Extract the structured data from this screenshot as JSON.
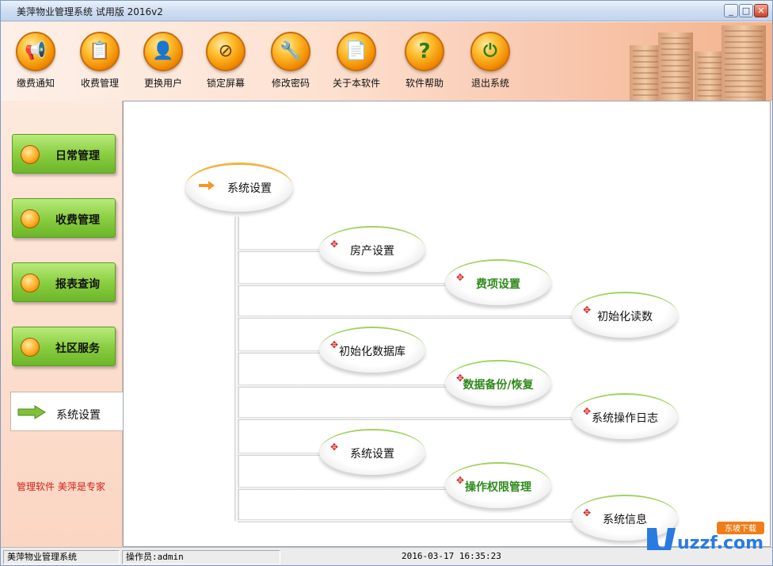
{
  "window": {
    "title": "美萍物业管理系统 试用版 2016v2"
  },
  "toolbar": {
    "items": [
      {
        "label": "缴费通知",
        "icon": "megaphone-icon",
        "glyph": "📢"
      },
      {
        "label": "收费管理",
        "icon": "receipt-icon",
        "glyph": "📋"
      },
      {
        "label": "更换用户",
        "icon": "user-switch-icon",
        "glyph": "👤"
      },
      {
        "label": "锁定屏幕",
        "icon": "lock-screen-icon",
        "glyph": "⊘"
      },
      {
        "label": "修改密码",
        "icon": "key-icon",
        "glyph": "🔧"
      },
      {
        "label": "关于本软件",
        "icon": "about-icon",
        "glyph": "📄"
      },
      {
        "label": "软件帮助",
        "icon": "help-icon",
        "glyph": "?"
      },
      {
        "label": "退出系统",
        "icon": "power-icon",
        "glyph": "⏻"
      }
    ]
  },
  "sidebar": {
    "items": [
      {
        "label": "日常管理"
      },
      {
        "label": "收费管理"
      },
      {
        "label": "报表查询"
      },
      {
        "label": "社区服务"
      }
    ],
    "active": {
      "label": "系统设置"
    },
    "slogan": "管理软件 美萍是专家"
  },
  "tree": {
    "root": {
      "label": "系统设置"
    },
    "nodes": [
      {
        "label": "房产设置"
      },
      {
        "label": "费项设置"
      },
      {
        "label": "初始化读数"
      },
      {
        "label": "初始化数据库"
      },
      {
        "label": "数据备份/恢复"
      },
      {
        "label": "系统操作日志"
      },
      {
        "label": "系统设置"
      },
      {
        "label": "操作权限管理"
      },
      {
        "label": "系统信息"
      }
    ]
  },
  "status": {
    "app": "美萍物业管理系统",
    "operator": "操作员:admin",
    "datetime": "2016-03-17 16:35:23"
  },
  "watermark": {
    "text": "uzzf.com",
    "tag": "东坡下载"
  },
  "colors": {
    "accent_green": "#87cc3e",
    "accent_orange": "#f08a00",
    "titlebar": "#cddcf1"
  }
}
